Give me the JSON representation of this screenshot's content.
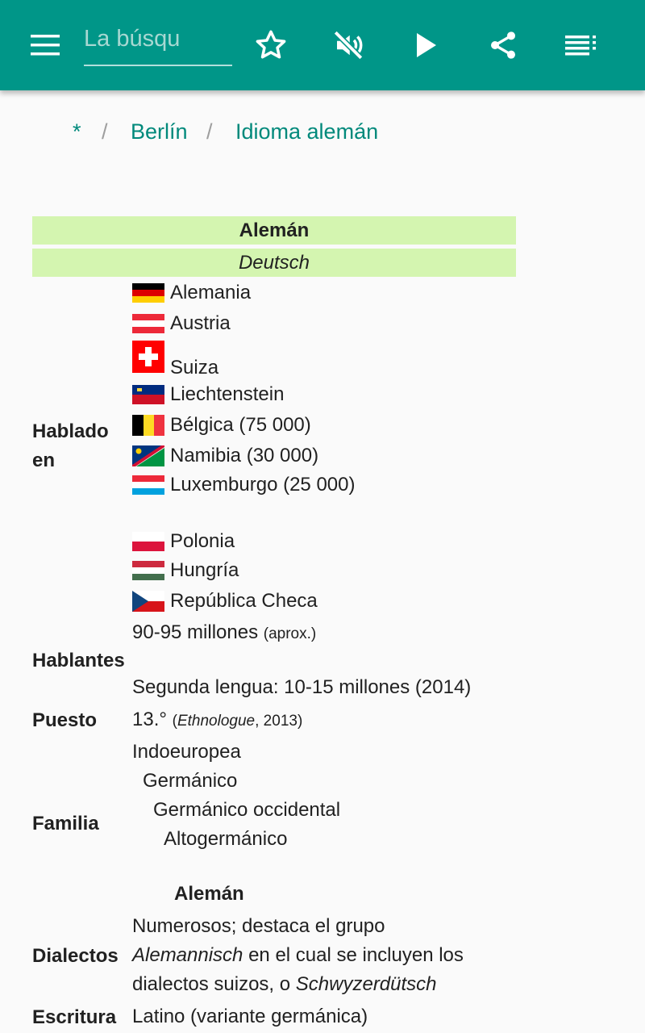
{
  "toolbar": {
    "menu_icon": "menu-icon",
    "search_placeholder": "La búsqu",
    "search_value": "",
    "bookmark_icon": "star-outline-icon",
    "mute_icon": "volume-off-icon",
    "play_icon": "play-icon",
    "share_icon": "share-icon",
    "toc_icon": "list-icon",
    "color": "#009688"
  },
  "breadcrumb": {
    "home": "*",
    "separator": "/",
    "items": [
      "Berlín",
      "Idioma alemán"
    ]
  },
  "infobox": {
    "title": "Alemán",
    "native_name": "Deutsch",
    "header_color": "#d4f5b0",
    "spoken_in_label": "Hablado en",
    "countries": [
      {
        "name": "Alemania",
        "flag": "germany-flag"
      },
      {
        "name": "Austria",
        "flag": "austria-flag"
      },
      {
        "name": "Suiza",
        "flag": "switzerland-flag"
      },
      {
        "name": "Liechtenstein",
        "flag": "liechtenstein-flag"
      },
      {
        "name": "Bélgica (75 000)",
        "flag": "belgium-flag"
      },
      {
        "name": "Namibia (30 000)",
        "flag": "namibia-flag"
      },
      {
        "name": "Luxemburgo (25 000)",
        "flag": "luxembourg-flag"
      },
      {
        "name": "Polonia",
        "flag": "poland-flag"
      },
      {
        "name": "Hungría",
        "flag": "hungary-flag"
      },
      {
        "name": "República Checa",
        "flag": "czech-republic-flag"
      }
    ],
    "speakers_label": "Hablantes",
    "speakers_value": "90-95 millones",
    "speakers_note": "(aprox.)",
    "speakers_second": "Segunda lengua: 10-15 millones (2014)",
    "rank_label": "Puesto",
    "rank_value": "13.°",
    "rank_note_open": "(",
    "rank_note_source": "Ethnologue",
    "rank_note_rest": ", 2013)",
    "family_label": "Familia",
    "family": [
      "Indoeuropea",
      "Germánico",
      "Germánico occidental",
      "Altogermánico"
    ],
    "family_current": "Alemán",
    "dialects_label": "Dialectos",
    "dialects_line1": "Numerosos; destaca el grupo",
    "dialects_italic1": "Alemannisch",
    "dialects_line2_rest": " en el cual se incluyen los",
    "dialects_line3_start": "dialectos suizos, o ",
    "dialects_italic2": "Schwyzerdütsch",
    "writing_label": "Escritura",
    "writing_value": "Latino (variante germánica)"
  }
}
